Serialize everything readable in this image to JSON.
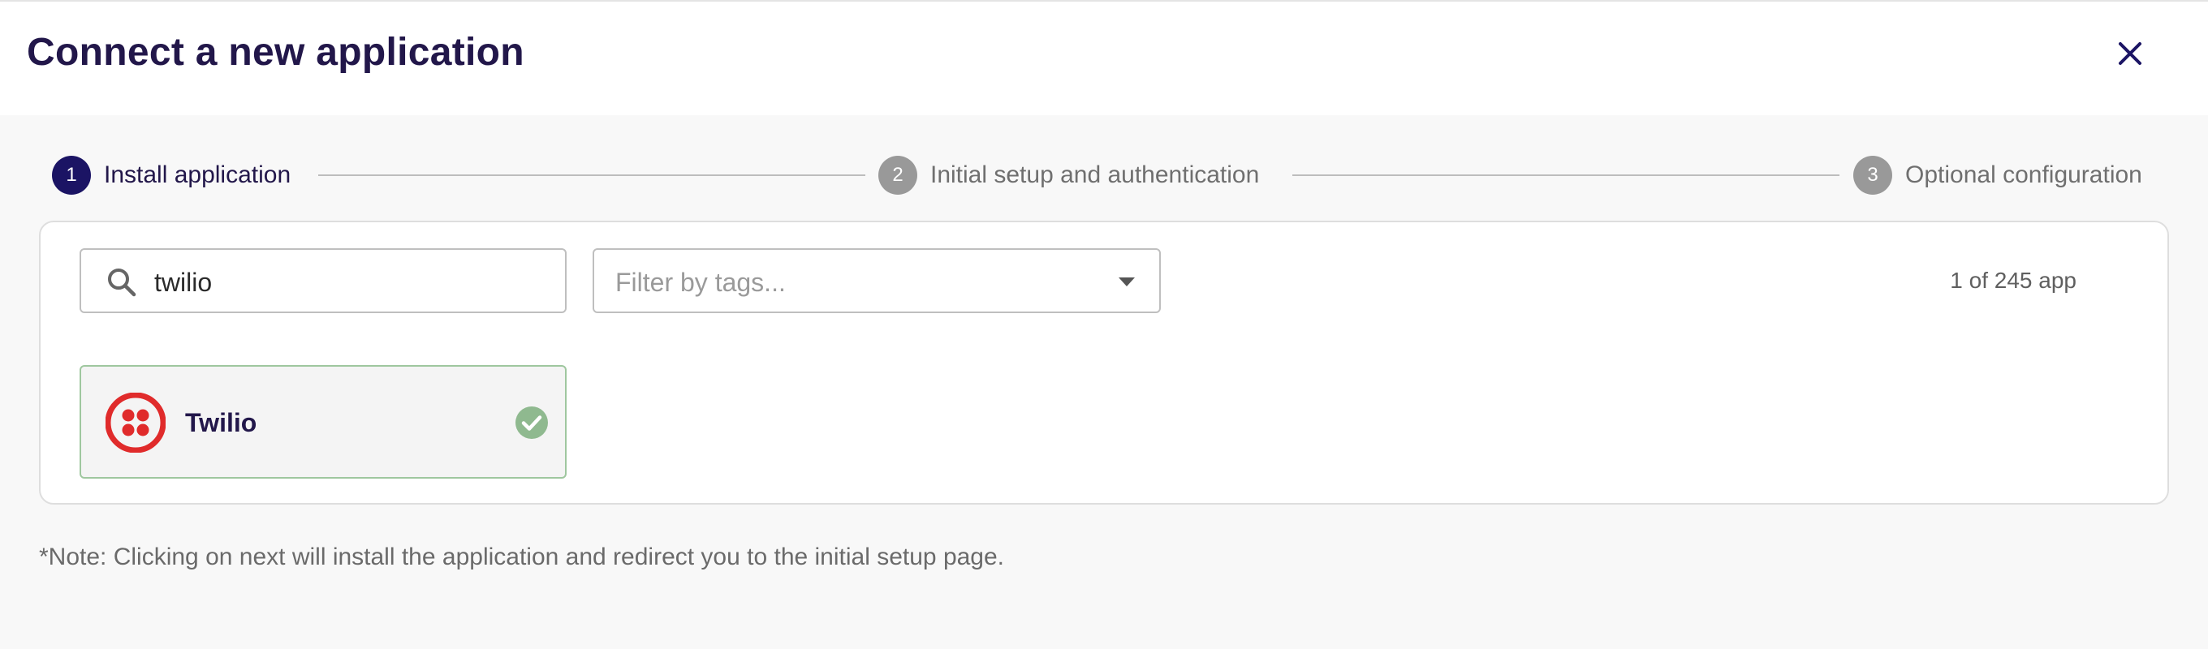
{
  "dialog": {
    "title": "Connect a new application"
  },
  "stepper": {
    "steps": [
      {
        "number": "1",
        "label": "Install application",
        "state": "active"
      },
      {
        "number": "2",
        "label": "Initial setup and authentication",
        "state": "inactive"
      },
      {
        "number": "3",
        "label": "Optional configuration",
        "state": "inactive"
      }
    ]
  },
  "search": {
    "value": "twilio",
    "icon": "search-icon"
  },
  "filter": {
    "placeholder": "Filter by tags...",
    "icon": "chevron-down-icon"
  },
  "results": {
    "count_text": "1 of 245 app"
  },
  "apps": [
    {
      "name": "Twilio",
      "logo": "twilio-logo",
      "selected": true,
      "status_icon": "check-circle-icon"
    }
  ],
  "note": "*Note: Clicking on next will install the application and redirect you to the initial setup page.",
  "colors": {
    "primary": "#1b1464",
    "title_text": "#22174a",
    "inactive_step": "#999999",
    "twilio_red": "#e02b2b",
    "success_green": "#8fb98f"
  }
}
